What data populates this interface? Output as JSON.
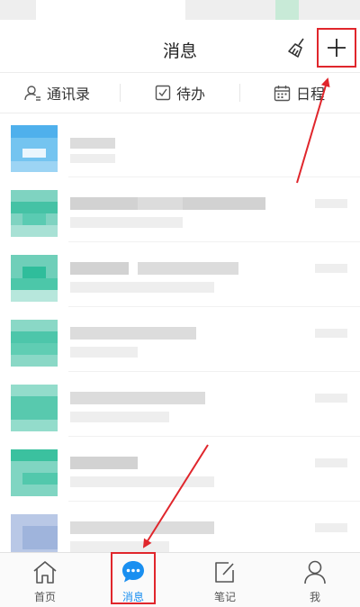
{
  "header": {
    "title": "消息",
    "broom_icon": "broom-icon",
    "add_icon": "plus-icon"
  },
  "quick_actions": [
    {
      "label": "通讯录",
      "icon": "contacts-icon"
    },
    {
      "label": "待办",
      "icon": "checkbox-icon"
    },
    {
      "label": "日程",
      "icon": "calendar-icon"
    }
  ],
  "tabs": [
    {
      "label": "首页",
      "icon": "home-icon",
      "active": false
    },
    {
      "label": "消息",
      "icon": "chat-bubble-icon",
      "active": true
    },
    {
      "label": "笔记",
      "icon": "note-edit-icon",
      "active": false
    },
    {
      "label": "我",
      "icon": "person-icon",
      "active": false
    }
  ],
  "colors": {
    "accent": "#1a8ff0",
    "annotation": "#e0262c",
    "avatar_blue": "#5bb8f0",
    "avatar_teal": "#3cc4a6"
  }
}
